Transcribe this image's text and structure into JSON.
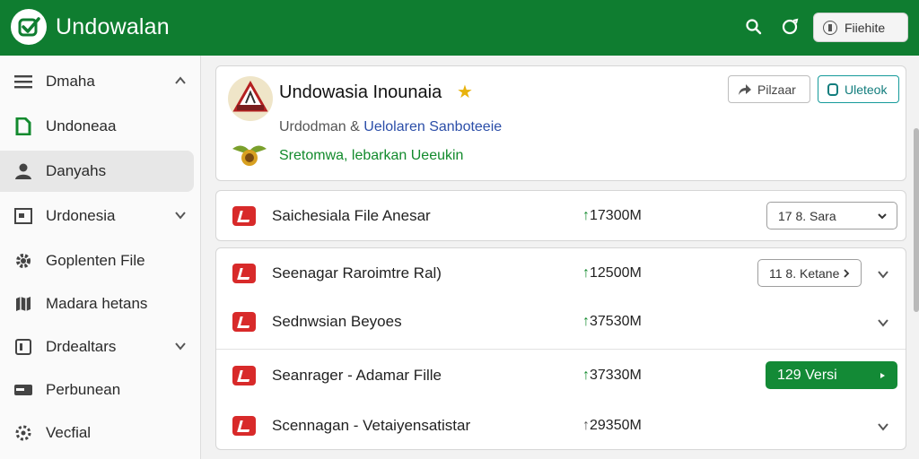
{
  "app": {
    "title": "Undowalan"
  },
  "header": {
    "button_label": "Fiiehite"
  },
  "sidebar": {
    "items": [
      {
        "label": "Dmaha",
        "icon": "menu-icon",
        "chevron": "up"
      },
      {
        "label": "Undoneaa",
        "icon": "document-icon",
        "chevron": ""
      },
      {
        "label": "Danyahs",
        "icon": "user-icon",
        "chevron": ""
      },
      {
        "label": "Urdonesia",
        "icon": "window-icon",
        "chevron": "down"
      },
      {
        "label": "Goplenten File",
        "icon": "gear-icon",
        "chevron": ""
      },
      {
        "label": "Madara hetans",
        "icon": "map-icon",
        "chevron": ""
      },
      {
        "label": "Drdealtars",
        "icon": "square-icon",
        "chevron": "down"
      },
      {
        "label": "Perbunean",
        "icon": "card-icon",
        "chevron": ""
      },
      {
        "label": "Vecfial",
        "icon": "settings-icon",
        "chevron": ""
      }
    ]
  },
  "profile": {
    "title": "Undowasia Inounaia",
    "subtitle_prefix": "Urdodman & ",
    "subtitle_highlight": "Uelolaren Sanboteeie",
    "meta": "Sretomwa, lebarkan Ueeukin",
    "button_share": "Pilzaar",
    "button_action": "Uleteok"
  },
  "files": [
    {
      "name": "Saichesiala File Anesar",
      "size": "17300M",
      "selector": "17 8. Sara",
      "selector_style": "outlined",
      "chevron": false
    },
    {
      "name": "Seenagar Raroimtre Ral)",
      "size": "12500M",
      "selector": "11 8. Ketane",
      "selector_style": "outlined",
      "chevron": true
    },
    {
      "name": "Sednwsian Beyoes",
      "size": "37530M",
      "selector": "",
      "selector_style": "",
      "chevron": true
    },
    {
      "name": "Seanrager - Adamar Fille",
      "size": "37330M",
      "selector": "129 Versi",
      "selector_style": "green",
      "chevron": false
    },
    {
      "name": "Scennagan - Vetaiyensatistar",
      "size": "29350M",
      "selector": "",
      "selector_style": "",
      "chevron": true
    }
  ],
  "colors": {
    "brand": "#0f7d30",
    "accent_teal": "#159a9a",
    "link_blue": "#2b4ea8",
    "meta_green": "#128a2c"
  }
}
